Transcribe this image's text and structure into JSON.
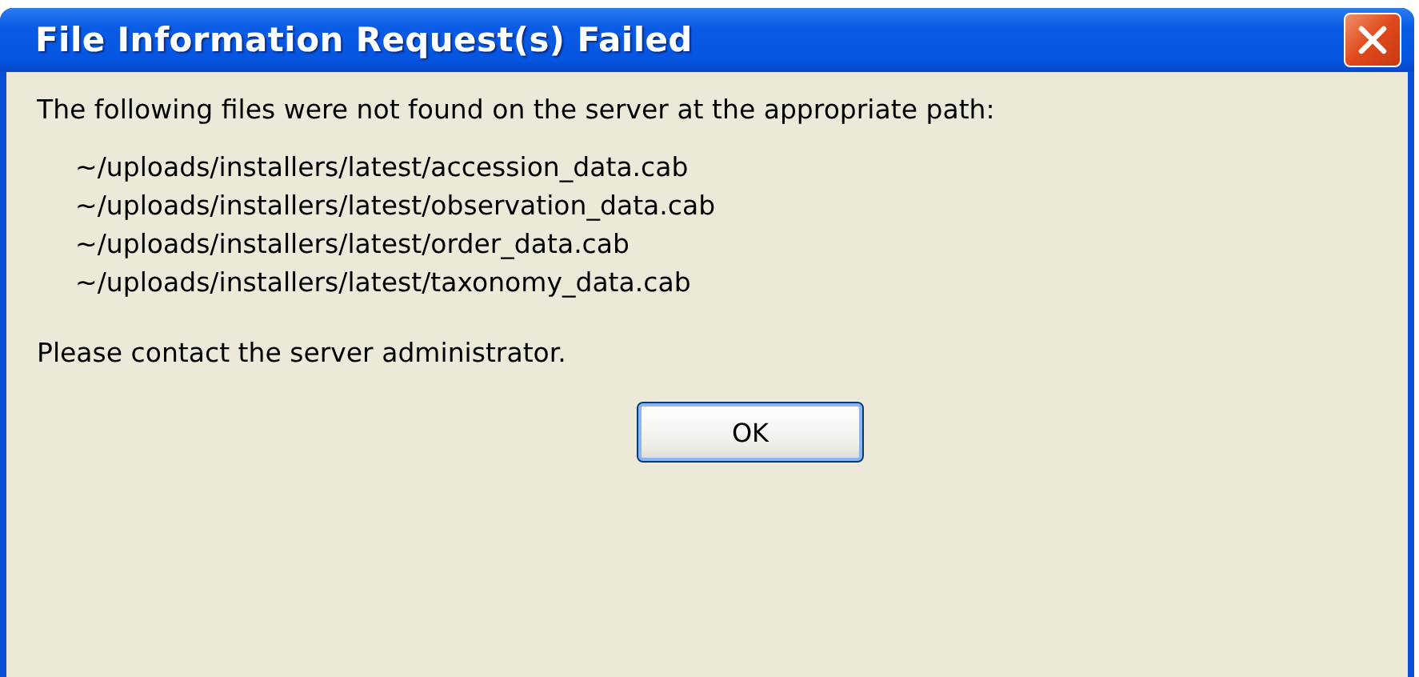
{
  "window": {
    "title": "File Information Request(s) Failed"
  },
  "message": "The following files were not found on the server at the appropriate path:",
  "files": [
    "~/uploads/installers/latest/accession_data.cab",
    "~/uploads/installers/latest/observation_data.cab",
    "~/uploads/installers/latest/order_data.cab",
    "~/uploads/installers/latest/taxonomy_data.cab"
  ],
  "footer": "Please contact the server administrator.",
  "buttons": [
    "OK"
  ]
}
